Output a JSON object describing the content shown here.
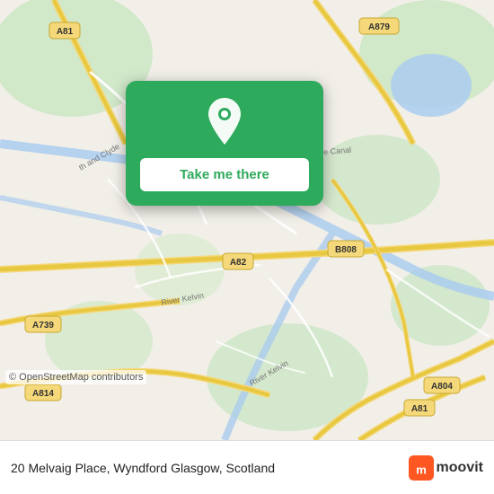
{
  "map": {
    "attribution": "© OpenStreetMap contributors",
    "background_color": "#e8e0d8"
  },
  "popup": {
    "button_label": "Take me there",
    "icon_name": "location-pin-icon"
  },
  "bottom_bar": {
    "address": "20 Melvaig Place, Wyndford Glasgow, Scotland",
    "logo_text": "moovit"
  }
}
